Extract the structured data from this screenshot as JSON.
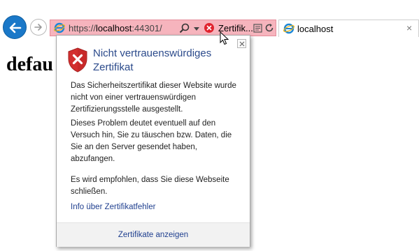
{
  "browser": {
    "address_bar": {
      "url_prefix": "https://",
      "url_host": "localhost",
      "url_suffix": ":44301/",
      "cert_status_label": "Zertifik...",
      "background_color": "#f6b4bd"
    },
    "tab": {
      "label": "localhost",
      "close_glyph": "×"
    },
    "icons": [
      "back-arrow-icon",
      "forward-arrow-icon",
      "ie-logo-icon",
      "search-icon",
      "chevron-down-icon",
      "cert-error-icon",
      "compat-view-icon",
      "refresh-icon",
      "close-icon"
    ]
  },
  "page": {
    "heading": "defau"
  },
  "flyout": {
    "title": "Nicht vertrauenswürdiges Zertifikat",
    "paragraphs": [
      "Das Sicherheitszertifikat dieser Website wurde nicht von einer vertrauenswürdigen Zertifizierungsstelle ausgestellt.",
      "Dieses Problem deutet eventuell auf den Versuch hin, Sie zu täuschen bzw. Daten, die Sie an den Server gesendet haben, abzufangen.",
      "Es wird empfohlen, dass Sie diese Webseite schließen."
    ],
    "link_info": "Info über Zertifikatfehler",
    "link_show_certs": "Zertifikate anzeigen",
    "title_color": "#2b4a8b",
    "link_color": "#1f3f8f",
    "shield_color": "#d32f2f"
  }
}
